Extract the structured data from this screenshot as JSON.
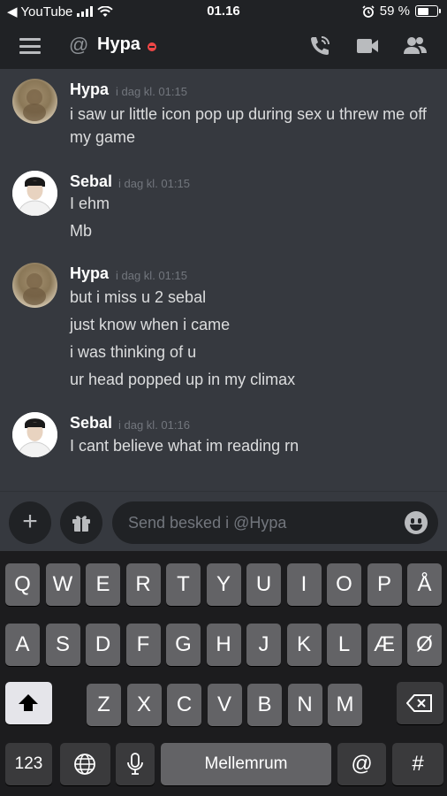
{
  "status_bar": {
    "back_app": "◀ YouTube",
    "time": "01.16",
    "battery_percent": "59 %",
    "battery_level": 0.59
  },
  "header": {
    "at_symbol": "@",
    "title": "Hypa",
    "status_color": "#f04747"
  },
  "messages": [
    {
      "author": "Hypa",
      "timestamp": "i dag kl. 01:15",
      "avatar": "hypa-avatar",
      "lines": [
        "i saw ur little icon pop up during sex u threw me off",
        "my game"
      ]
    },
    {
      "author": "Sebal",
      "timestamp": "i dag kl. 01:15",
      "avatar": "sebal-avatar",
      "lines": [
        "I ehm",
        "Mb"
      ]
    },
    {
      "author": "Hypa",
      "timestamp": "i dag kl. 01:15",
      "avatar": "hypa-avatar",
      "lines": [
        "but i miss u 2 sebal",
        "just know when i came",
        "i was thinking of u",
        "ur head popped up in my climax"
      ]
    },
    {
      "author": "Sebal",
      "timestamp": "i dag kl. 01:16",
      "avatar": "sebal-avatar",
      "lines": [
        "I cant believe what im reading rn"
      ]
    }
  ],
  "composer": {
    "add_label": "+",
    "placeholder": "Send besked i @Hypa"
  },
  "keyboard": {
    "row1": [
      "Q",
      "W",
      "E",
      "R",
      "T",
      "Y",
      "U",
      "I",
      "O",
      "P",
      "Å"
    ],
    "row2": [
      "A",
      "S",
      "D",
      "F",
      "G",
      "H",
      "J",
      "K",
      "L",
      "Æ",
      "Ø"
    ],
    "row3": [
      "Z",
      "X",
      "C",
      "V",
      "B",
      "N",
      "M"
    ],
    "numbers_key": "123",
    "space_key": "Mellemrum",
    "at_key": "@",
    "hash_key": "#"
  },
  "colors": {
    "background": "#36393f",
    "header": "#202225",
    "keyboard": "#1c1c1e"
  }
}
